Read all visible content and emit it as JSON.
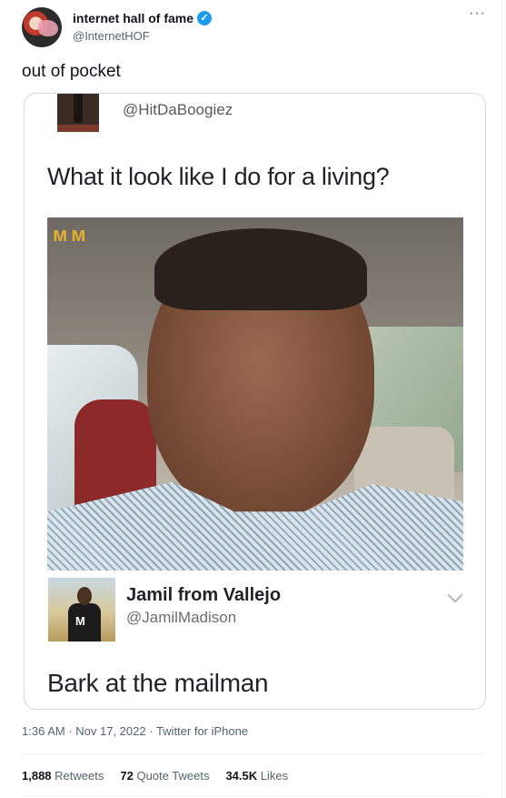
{
  "author": {
    "name": "internet hall of fame",
    "handle": "@InternetHOF",
    "verified_icon": "✓",
    "more": "···"
  },
  "tweet": {
    "text": "out of pocket"
  },
  "card": {
    "top_handle": "@HitDaBoogiez",
    "question": "What it look like I do for a living?",
    "photo_mark": "ᴍᴍ",
    "quoted_name": "Jamil from Vallejo",
    "quoted_handle": "@JamilMadison",
    "profile_logo": "M",
    "reply_text": "Bark at the mailman"
  },
  "meta": {
    "time": "1:36 AM",
    "date": "Nov 17, 2022",
    "source": "Twitter for iPhone",
    "separator": " · "
  },
  "stats": {
    "retweets_count": "1,888",
    "retweets_label": "Retweets",
    "quotes_count": "72",
    "quotes_label": "Quote Tweets",
    "likes_count": "34.5K",
    "likes_label": "Likes"
  },
  "colors": {
    "verified": "#1d9bf0",
    "secondary_text": "#536471",
    "border": "#cfd9de"
  }
}
